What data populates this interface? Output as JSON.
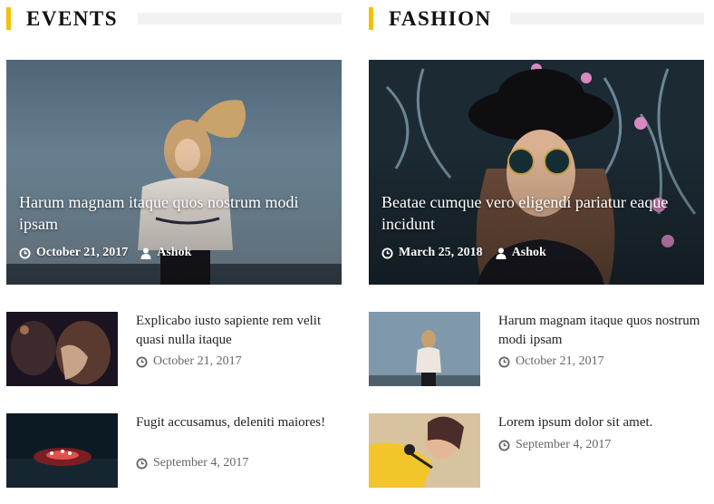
{
  "sections": [
    {
      "title": "EVENTS",
      "featured": {
        "title": "Harum magnam itaque quos nostrum modi ipsam",
        "date": "October 21, 2017",
        "author": "Ashok"
      },
      "items": [
        {
          "title": "Explicabo iusto sapiente rem velit quasi nulla itaque",
          "date": "October 21, 2017"
        },
        {
          "title": "Fugit accusamus, deleniti maiores!",
          "date": "September 4, 2017"
        }
      ]
    },
    {
      "title": "FASHION",
      "featured": {
        "title": "Beatae cumque vero eligendi pariatur eaque incidunt",
        "date": "March 25, 2018",
        "author": "Ashok"
      },
      "items": [
        {
          "title": "Harum magnam itaque quos nostrum modi ipsam",
          "date": "October 21, 2017"
        },
        {
          "title": "Lorem ipsum dolor sit amet.",
          "date": "September 4, 2017"
        }
      ]
    }
  ],
  "icons": {
    "date": "clock-icon",
    "author": "user-icon"
  },
  "colors": {
    "accent": "#f2c200",
    "date_text": "#666666",
    "divider": "#f1f2f3"
  }
}
